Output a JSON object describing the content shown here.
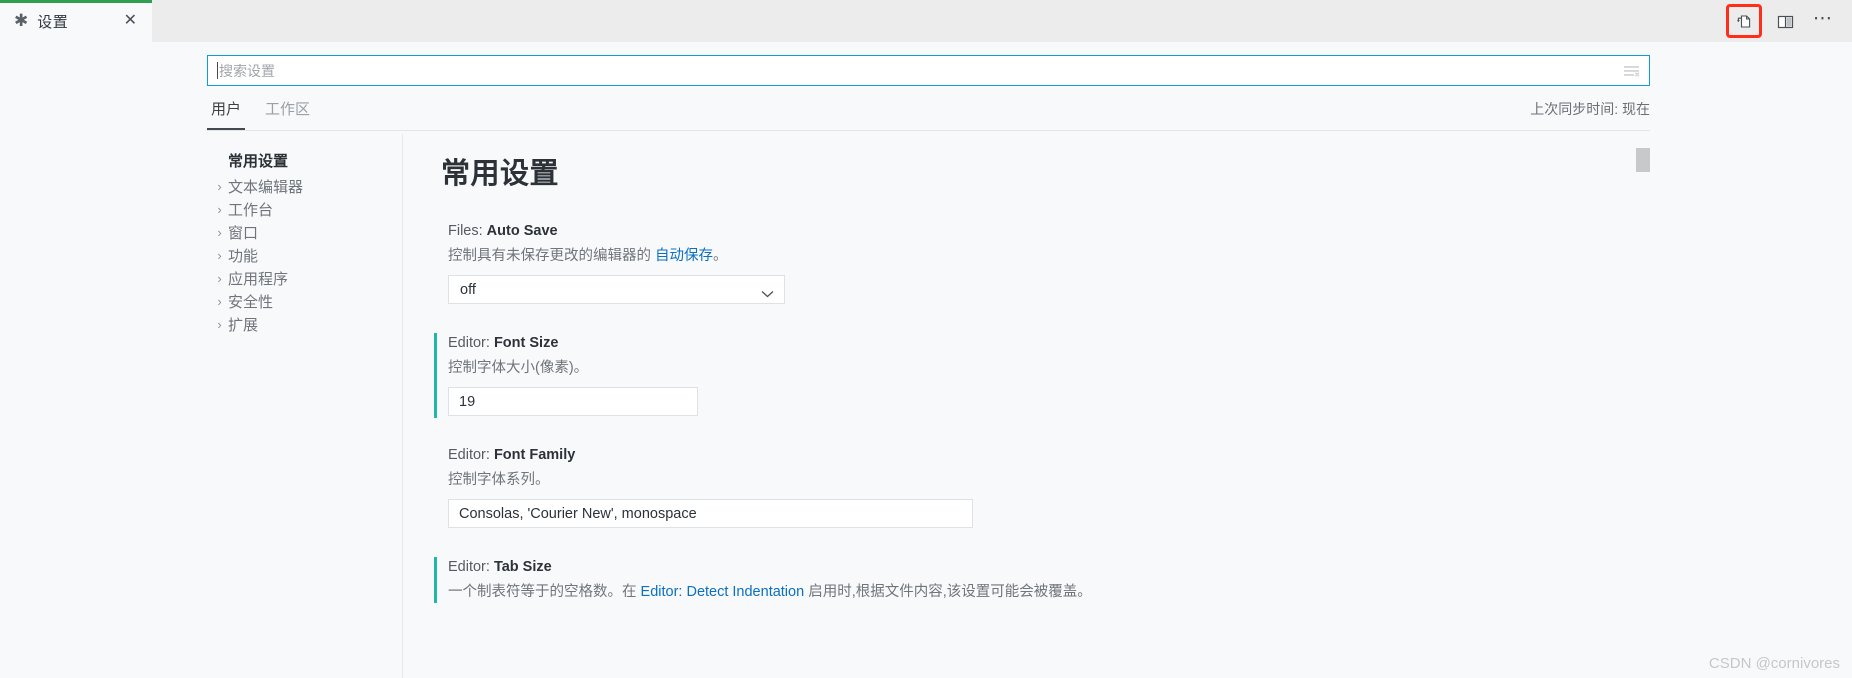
{
  "window": {
    "tab": {
      "dirty_glyph": "✱",
      "title": "设置",
      "close_glyph": "✕",
      "accent_color": "#2e9e4f"
    },
    "actions": {
      "open_settings_json_label": "open-settings-json",
      "split_editor_label": "split-editor",
      "more_label": "⋯"
    },
    "highlight_color": "#ff2d1a"
  },
  "search": {
    "placeholder": "搜索设置",
    "value": "",
    "filter_icon": "filter-icon",
    "border_color": "#0f9bd7"
  },
  "scope": {
    "tabs": [
      {
        "label": "用户",
        "active": true
      },
      {
        "label": "工作区",
        "active": false
      }
    ],
    "sync_status": "上次同步时间: 现在"
  },
  "toc": {
    "root": "常用设置",
    "items": [
      {
        "label": "文本编辑器",
        "twisty": "›"
      },
      {
        "label": "工作台",
        "twisty": "›"
      },
      {
        "label": "窗口",
        "twisty": "›"
      },
      {
        "label": "功能",
        "twisty": "›"
      },
      {
        "label": "应用程序",
        "twisty": "›"
      },
      {
        "label": "安全性",
        "twisty": "›"
      },
      {
        "label": "扩展",
        "twisty": "›"
      }
    ]
  },
  "content": {
    "heading": "常用设置",
    "settings": [
      {
        "prefix": "Files: ",
        "name": "Auto Save",
        "desc_before": "控制具有未保存更改的编辑器的 ",
        "desc_link": "自动保存",
        "desc_after": "。",
        "control": "select",
        "value": "off",
        "modified": false
      },
      {
        "prefix": "Editor: ",
        "name": "Font Size",
        "desc_before": "控制字体大小(像素)。",
        "desc_link": "",
        "desc_after": "",
        "control": "number",
        "value": "19",
        "modified": true
      },
      {
        "prefix": "Editor: ",
        "name": "Font Family",
        "desc_before": "控制字体系列。",
        "desc_link": "",
        "desc_after": "",
        "control": "text",
        "value": "Consolas, 'Courier New', monospace",
        "modified": false
      },
      {
        "prefix": "Editor: ",
        "name": "Tab Size",
        "desc_before": "一个制表符等于的空格数。在 ",
        "desc_link": "Editor: Detect Indentation",
        "desc_after": " 启用时,根据文件内容,该设置可能会被覆盖。",
        "control": "none",
        "value": "",
        "modified": true
      }
    ],
    "modified_marker_color": "#21b8a6"
  },
  "watermark": "CSDN @cornivores"
}
